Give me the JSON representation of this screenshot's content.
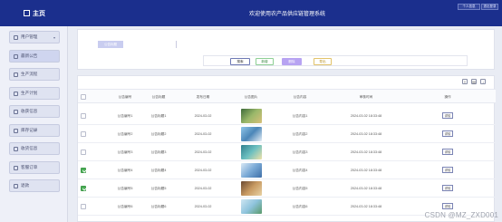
{
  "header": {
    "home_label": "主页",
    "title": "欢迎使用农产品供应链管理系统",
    "top_buttons": [
      "个人信息",
      "退出登录"
    ]
  },
  "sidebar": {
    "items": [
      {
        "label": "用户管理"
      },
      {
        "label": "最新公告"
      },
      {
        "label": "生产流程"
      },
      {
        "label": "生产计划"
      },
      {
        "label": "收获信息"
      },
      {
        "label": "库存记录"
      },
      {
        "label": "收货信息"
      },
      {
        "label": "客服订单"
      },
      {
        "label": "退款"
      }
    ]
  },
  "search": {
    "label": "公告标题",
    "placeholder": ""
  },
  "actions": {
    "search": "搜索",
    "add": "新增",
    "delete": "删除",
    "export": "导出"
  },
  "table": {
    "columns": [
      "公告编号",
      "公告标题",
      "发布日期",
      "公告图片",
      "公告内容",
      "审核时间",
      "操作"
    ],
    "rows": [
      {
        "no": "公告编号1",
        "title": "公告标题1",
        "date": "2024-03-02",
        "content": "公告内容1",
        "time": "2024-03-02 18:33:48",
        "op": "详情",
        "checked": false
      },
      {
        "no": "公告编号2",
        "title": "公告标题2",
        "date": "2024-03-02",
        "content": "公告内容2",
        "time": "2024-03-02 18:33:48",
        "op": "详情",
        "checked": false
      },
      {
        "no": "公告编号3",
        "title": "公告标题3",
        "date": "2024-03-02",
        "content": "公告内容3",
        "time": "2024-03-02 18:33:48",
        "op": "详情",
        "checked": false
      },
      {
        "no": "公告编号4",
        "title": "公告标题4",
        "date": "2024-03-02",
        "content": "公告内容4",
        "time": "2024-03-02 18:33:48",
        "op": "详情",
        "checked": true
      },
      {
        "no": "公告编号5",
        "title": "公告标题5",
        "date": "2024-03-02",
        "content": "公告内容5",
        "time": "2024-03-02 18:33:48",
        "op": "详情",
        "checked": true
      },
      {
        "no": "公告编号6",
        "title": "公告标题6",
        "date": "2024-03-02",
        "content": "公告内容6",
        "time": "2024-03-02 18:33:48",
        "op": "详情",
        "checked": false
      }
    ]
  },
  "watermark": "CSDN @MZ_ZXD001",
  "colors": {
    "header_bg": "#1b2f8d",
    "page_bg": "#e9ecf4",
    "accent_green": "#4cae58",
    "accent_purple": "#b7a3f2"
  }
}
